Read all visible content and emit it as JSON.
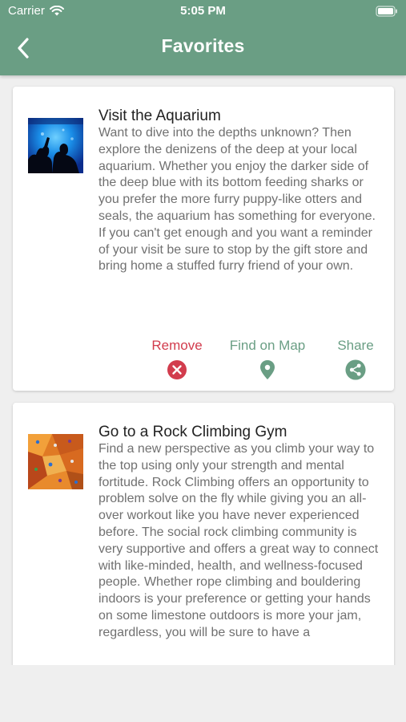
{
  "status_bar": {
    "carrier": "Carrier",
    "time": "5:05 PM"
  },
  "nav": {
    "title": "Favorites"
  },
  "colors": {
    "header_bg": "#6a9e84",
    "accent_green": "#6a9e84",
    "remove_red": "#d23c4d",
    "background": "#efefef"
  },
  "favorites": [
    {
      "title": "Visit the Aquarium",
      "description": "Want to dive into the depths unknown? Then explore the denizens of the deep at your local aquarium. Whether you enjoy the darker side of the deep blue with its bottom feeding sharks or you prefer the more furry puppy-like otters and seals, the aquarium has something for everyone. If you can't get enough and you want a reminder of your visit be sure to stop by the gift store and bring home a stuffed furry friend of your own.",
      "image_icon": "aquarium-photo",
      "actions": {
        "remove": "Remove",
        "map": "Find on Map",
        "share": "Share"
      }
    },
    {
      "title": "Go to a Rock Climbing Gym",
      "description": "Find a new perspective as you climb your way to the top using only your strength and mental fortitude. Rock Climbing offers an opportunity to problem solve on the fly while giving you an all-over workout like you have never experienced before. The social rock climbing community is very supportive and offers a great way to connect with like-minded, health, and wellness-focused people. Whether rope climbing and bouldering indoors is your preference or getting your hands on some limestone outdoors is more your jam, regardless, you will be sure to have a",
      "image_icon": "climbing-wall-photo"
    }
  ]
}
